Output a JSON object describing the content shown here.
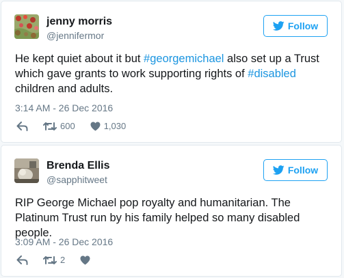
{
  "tweets": [
    {
      "name": "jenny morris",
      "handle": "@jennifermor",
      "follow_label": "Follow",
      "text": [
        {
          "t": "He kept quiet about it but "
        },
        {
          "t": "#georgemichael",
          "hashtag": true
        },
        {
          "t": " also set up a Trust which gave grants to work supporting rights of "
        },
        {
          "t": "#disabled",
          "hashtag": true
        },
        {
          "t": " children and adults."
        }
      ],
      "timestamp": "3:14 AM - 26 Dec 2016",
      "retweets": "600",
      "likes": "1,030"
    },
    {
      "name": "Brenda Ellis",
      "handle": "@sapphitweet",
      "follow_label": "Follow",
      "text": [
        {
          "t": "RIP George Michael pop royalty and humanitarian. The Platinum Trust run by his family helped so many disabled people."
        }
      ],
      "timestamp": "3:09 AM - 26 Dec 2016",
      "retweets": "2",
      "likes": ""
    }
  ],
  "colors": {
    "accent": "#1da1f2",
    "hashtag": "#1b95e0",
    "muted": "#657786",
    "border": "#e1e8ed"
  },
  "icons": [
    "reply-icon",
    "retweet-icon",
    "heart-icon",
    "twitter-bird-icon"
  ]
}
